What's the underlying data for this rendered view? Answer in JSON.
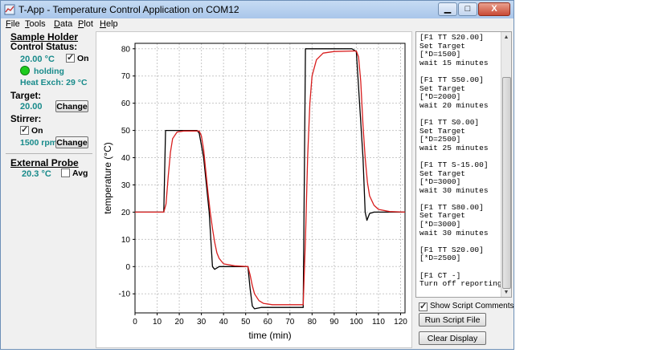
{
  "window": {
    "title": "T-App - Temperature Control Application  on COM12",
    "controls": {
      "minimize": "▁",
      "maximize": "□",
      "close": "X"
    }
  },
  "menu": [
    {
      "label": "File",
      "key": "F",
      "rest": "ile"
    },
    {
      "label": "Tools",
      "key": "T",
      "rest": "ools"
    },
    {
      "label": "Data",
      "key": "D",
      "rest": "ata"
    },
    {
      "label": "Plot",
      "key": "P",
      "rest": "lot"
    },
    {
      "label": "Help",
      "key": "H",
      "rest": "elp"
    }
  ],
  "sample_holder": {
    "title": "Sample Holder",
    "control_status_label": "Control Status:",
    "temperature": "20.00 °C",
    "on_label": "On",
    "on_checked": true,
    "state": "holding",
    "heat_exch": "Heat Exch:  29 °C"
  },
  "target": {
    "label": "Target:",
    "value": "20.00",
    "change_button": "Change"
  },
  "stirrer": {
    "label": "Stirrer:",
    "on_label": "On",
    "on_checked": true,
    "rpm": "1500 rpm",
    "change_button": "Change"
  },
  "external_probe": {
    "title": "External Probe",
    "value": "20.3 °C",
    "avg_label": "Avg",
    "avg_checked": false
  },
  "colors": {
    "status_teal": "#178a8a",
    "indicator_green": "#1ecb1e",
    "series_measured": "#000000",
    "series_setpoint": "#d81e1e"
  },
  "chart_data": {
    "type": "line",
    "xlabel": "time (min)",
    "ylabel": "temperature (°C)",
    "xlim": [
      0,
      122
    ],
    "ylim": [
      -17,
      82
    ],
    "xticks": [
      0,
      10,
      20,
      30,
      40,
      50,
      60,
      70,
      80,
      90,
      100,
      110,
      120
    ],
    "yticks": [
      -10,
      0,
      10,
      20,
      30,
      40,
      50,
      60,
      70,
      80
    ],
    "grid": true,
    "series": [
      {
        "color": "#000000",
        "points": [
          [
            0,
            20
          ],
          [
            13,
            20
          ],
          [
            13.8,
            50
          ],
          [
            28,
            50
          ],
          [
            29,
            49
          ],
          [
            31,
            40
          ],
          [
            33.5,
            20
          ],
          [
            35,
            0
          ],
          [
            36,
            -1
          ],
          [
            38,
            0
          ],
          [
            51,
            0
          ],
          [
            52,
            -8
          ],
          [
            53,
            -14.5
          ],
          [
            54,
            -15.5
          ],
          [
            57,
            -15
          ],
          [
            76,
            -15
          ],
          [
            77,
            80
          ],
          [
            98,
            80
          ],
          [
            100,
            79
          ],
          [
            103,
            40
          ],
          [
            104,
            20
          ],
          [
            104.8,
            17
          ],
          [
            106,
            19.5
          ],
          [
            108,
            20
          ],
          [
            122,
            20
          ]
        ]
      },
      {
        "color": "#d81e1e",
        "points": [
          [
            0,
            20
          ],
          [
            13,
            20
          ],
          [
            14,
            23
          ],
          [
            15,
            33
          ],
          [
            16,
            42
          ],
          [
            17,
            47
          ],
          [
            19,
            49.4
          ],
          [
            22,
            49.8
          ],
          [
            29,
            49.8
          ],
          [
            30,
            48
          ],
          [
            31,
            43
          ],
          [
            32,
            35
          ],
          [
            33,
            27
          ],
          [
            34,
            20
          ],
          [
            35,
            14
          ],
          [
            36,
            9
          ],
          [
            37,
            5
          ],
          [
            38,
            3
          ],
          [
            40,
            1
          ],
          [
            45,
            0.3
          ],
          [
            51,
            0
          ],
          [
            52,
            -3
          ],
          [
            53,
            -7
          ],
          [
            54,
            -10
          ],
          [
            56,
            -12.5
          ],
          [
            58,
            -13.5
          ],
          [
            62,
            -14
          ],
          [
            76,
            -14
          ],
          [
            77,
            10
          ],
          [
            78,
            40
          ],
          [
            79,
            60
          ],
          [
            80,
            70
          ],
          [
            82,
            76
          ],
          [
            85,
            78.4
          ],
          [
            90,
            79
          ],
          [
            100,
            79.2
          ],
          [
            101,
            77
          ],
          [
            102,
            68
          ],
          [
            103,
            52
          ],
          [
            104,
            40
          ],
          [
            105,
            31
          ],
          [
            106,
            26
          ],
          [
            108,
            22.5
          ],
          [
            110,
            21
          ],
          [
            115,
            20.2
          ],
          [
            122,
            20
          ]
        ]
      }
    ]
  },
  "script": {
    "lines": [
      "[F1 TT S20.00]",
      "Set Target",
      "[*D=1500]",
      "wait 15 minutes",
      "",
      "[F1 TT S50.00]",
      "Set Target",
      "[*D=2000]",
      "wait 20 minutes",
      "",
      "[F1 TT S0.00]",
      "Set Target",
      "[*D=2500]",
      "wait 25 minutes",
      "",
      "[F1 TT S-15.00]",
      "Set Target",
      "[*D=3000]",
      "wait 30 minutes",
      "",
      "[F1 TT S80.00]",
      "Set Target",
      "[*D=3000]",
      "wait 30 minutes",
      "",
      "[F1 TT S20.00]",
      "[*D=2500]",
      "",
      "[F1 CT -]",
      "Turn off reporting"
    ],
    "show_comments_label": "Show Script Comments",
    "show_comments_checked": true,
    "run_button": "Run Script File",
    "clear_button": "Clear Display"
  }
}
